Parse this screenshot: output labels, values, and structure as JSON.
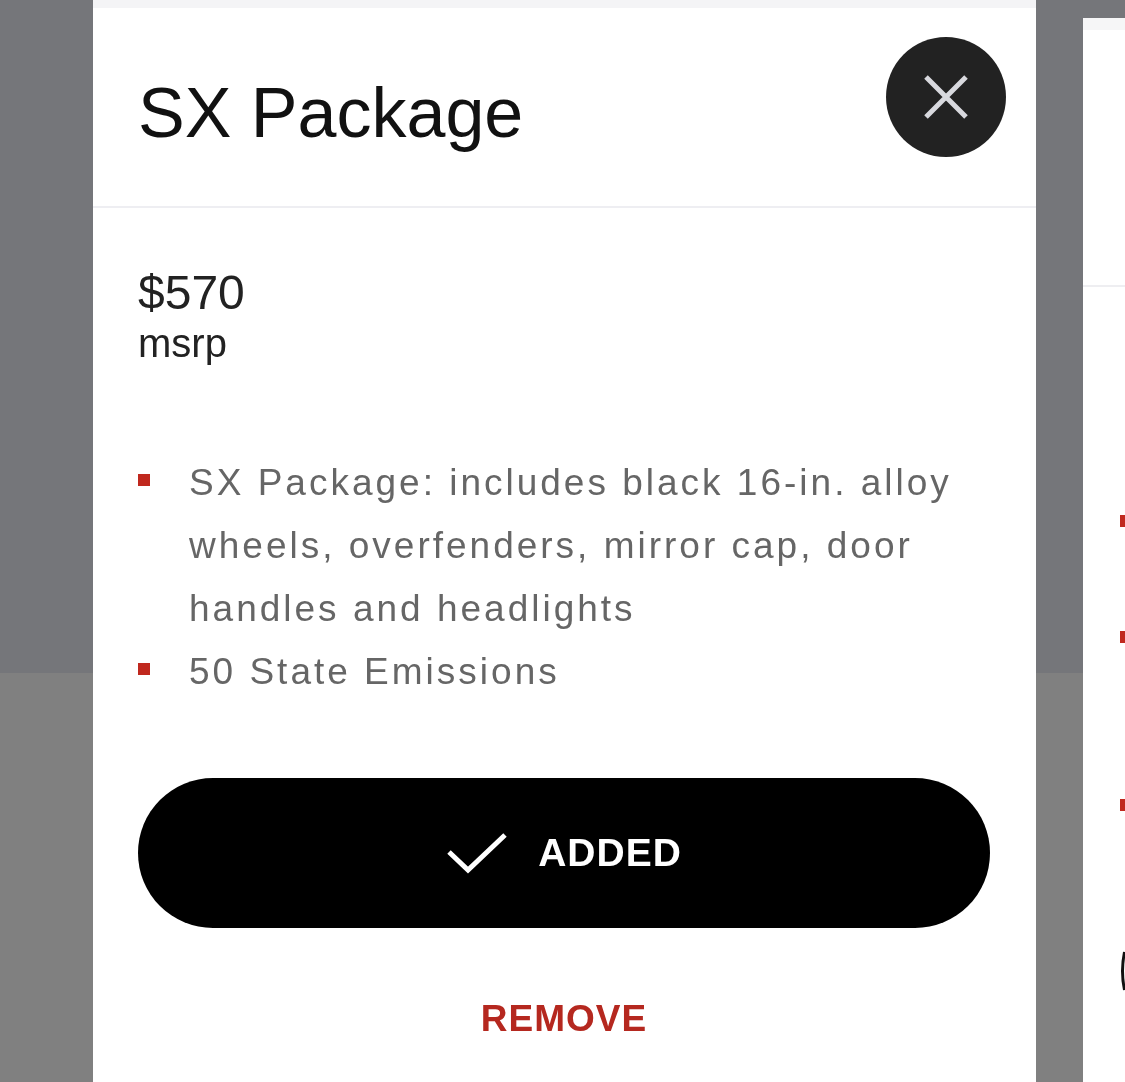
{
  "modal": {
    "title": "SX Package",
    "price": "$570",
    "price_label": "msrp",
    "features": [
      "SX Package: includes black 16-in. alloy wheels, overfenders, mirror cap, door handles and headlights",
      "50 State Emissions"
    ],
    "primary_button": {
      "label": "ADDED",
      "added": true
    },
    "secondary_button": {
      "label": "REMOVE"
    }
  }
}
